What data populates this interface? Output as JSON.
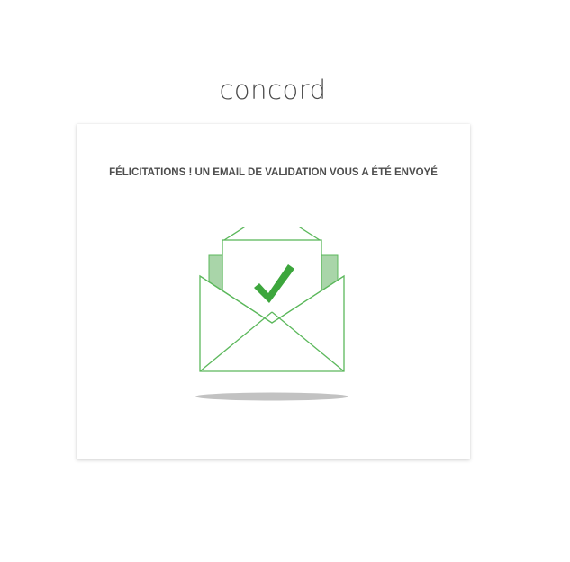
{
  "brand": {
    "logo_text": "concord"
  },
  "confirmation": {
    "title": "FÉLICITATIONS ! UN EMAIL DE VALIDATION VOUS A ÉTÉ ENVOYÉ",
    "illustration_icon": "envelope-check-icon"
  },
  "colors": {
    "accent_green": "#3da63d",
    "outline_green": "#5cb85c",
    "light_green": "#a9d5a9",
    "shadow_gray": "#c2c2c2",
    "logo_text": "#4a4a4a"
  }
}
